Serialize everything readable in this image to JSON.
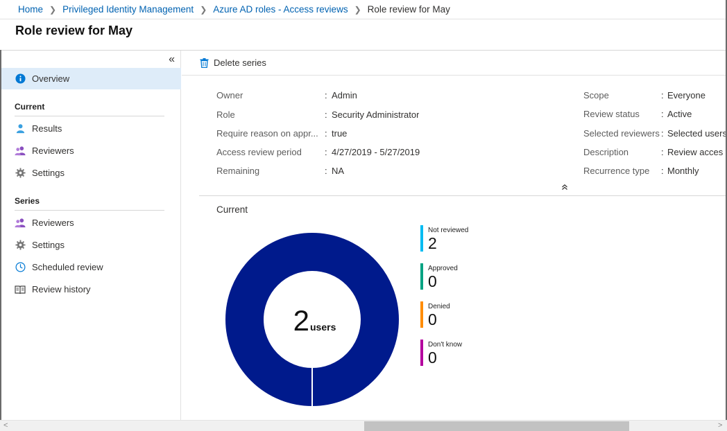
{
  "breadcrumb": {
    "items": [
      "Home",
      "Privileged Identity Management",
      "Azure AD roles - Access reviews"
    ],
    "current": "Role review for May"
  },
  "page": {
    "title": "Role review for May"
  },
  "sidebar": {
    "collapse_glyph": "«",
    "overview": {
      "label": "Overview",
      "icon": "info-icon"
    },
    "current_section": "Current",
    "current_items": [
      {
        "label": "Results",
        "icon": "user-icon"
      },
      {
        "label": "Reviewers",
        "icon": "users-icon"
      },
      {
        "label": "Settings",
        "icon": "gear-icon"
      }
    ],
    "series_section": "Series",
    "series_items": [
      {
        "label": "Reviewers",
        "icon": "users-icon"
      },
      {
        "label": "Settings",
        "icon": "gear-icon"
      },
      {
        "label": "Scheduled review",
        "icon": "clock-icon"
      },
      {
        "label": "Review history",
        "icon": "book-icon"
      }
    ]
  },
  "toolbar": {
    "delete_label": "Delete series"
  },
  "essentials": {
    "left": [
      {
        "label": "Owner",
        "value": "Admin"
      },
      {
        "label": "Role",
        "value": "Security Administrator"
      },
      {
        "label": "Require reason on appr...",
        "value": "true"
      },
      {
        "label": "Access review period",
        "value": "4/27/2019 - 5/27/2019"
      },
      {
        "label": "Remaining",
        "value": "NA"
      }
    ],
    "right": [
      {
        "label": "Scope",
        "value": "Everyone"
      },
      {
        "label": "Review status",
        "value": "Active"
      },
      {
        "label": "Selected reviewers",
        "value": "Selected users"
      },
      {
        "label": "Description",
        "value": "Review acces fo"
      },
      {
        "label": "Recurrence type",
        "value": "Monthly"
      }
    ],
    "colon": ":",
    "collapse_glyph": "⌃"
  },
  "chart": {
    "section_label": "Current",
    "total": "2",
    "unit": "users"
  },
  "chart_data": {
    "type": "pie",
    "categories": [
      "Not reviewed",
      "Approved",
      "Denied",
      "Don't know"
    ],
    "values": [
      2,
      0,
      0,
      0
    ],
    "colors": [
      "#00bcf2",
      "#00a383",
      "#ff8c00",
      "#b4009e"
    ],
    "fill_color": "#001a8c",
    "center_value": "2",
    "center_unit": "users"
  },
  "legend": [
    {
      "label": "Not reviewed",
      "value": "2",
      "color": "#00bcf2"
    },
    {
      "label": "Approved",
      "value": "0",
      "color": "#00a383"
    },
    {
      "label": "Denied",
      "value": "0",
      "color": "#ff8c00"
    },
    {
      "label": "Don't know",
      "value": "0",
      "color": "#b4009e"
    }
  ],
  "scrollbar": {
    "left_arrow": "<",
    "right_arrow": ">"
  }
}
